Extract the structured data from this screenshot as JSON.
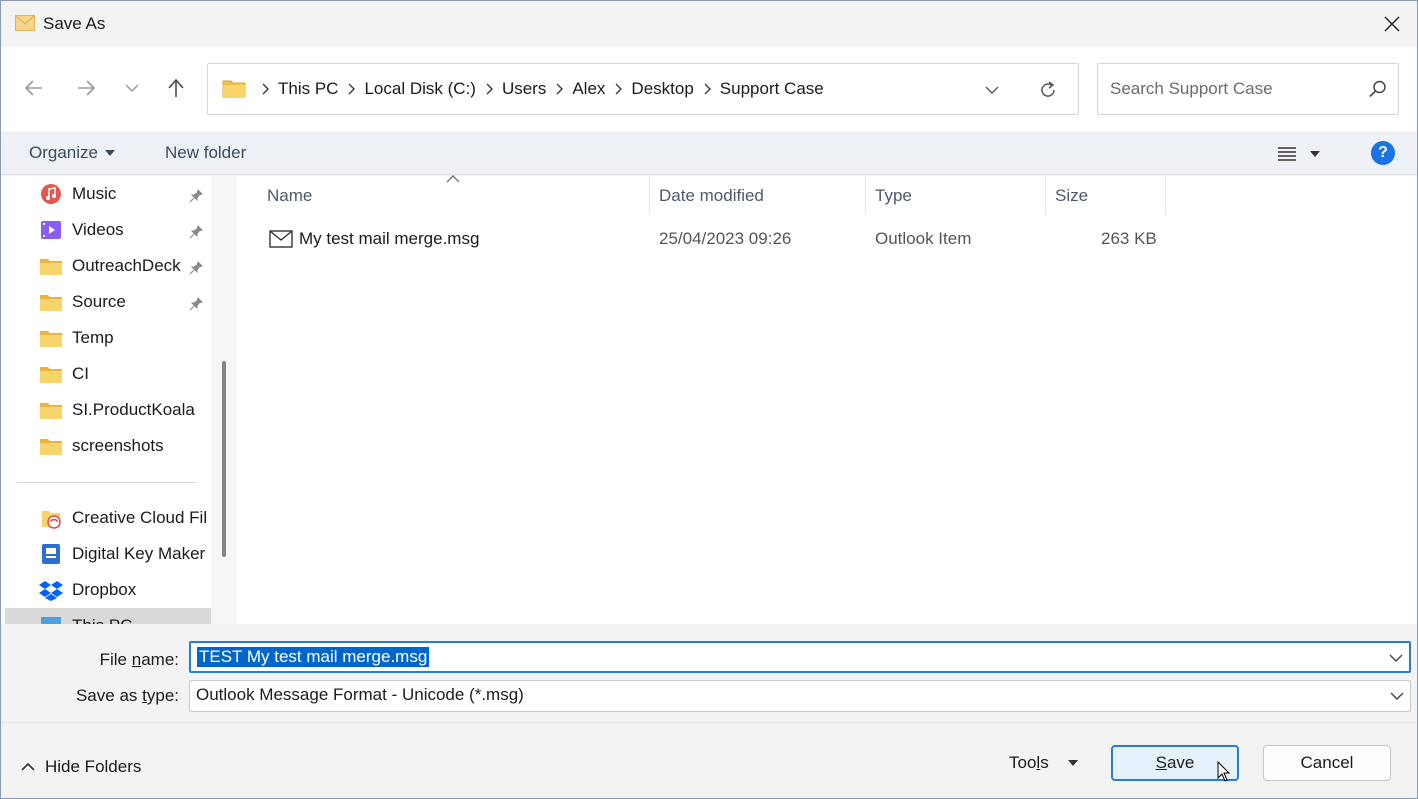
{
  "window": {
    "title": "Save As",
    "icon": "envelope-icon"
  },
  "nav": {
    "back_icon": "back-arrow-icon",
    "forward_icon": "forward-arrow-icon",
    "recent_icon": "chevron-down-icon",
    "up_icon": "up-arrow-icon"
  },
  "address": {
    "crumbs": [
      "This PC",
      "Local Disk (C:)",
      "Users",
      "Alex",
      "Desktop",
      "Support Case"
    ]
  },
  "search": {
    "placeholder": "Search Support Case"
  },
  "toolbar": {
    "organize_label": "Organize",
    "new_folder_label": "New folder",
    "help_label": "?"
  },
  "sidebar": {
    "items": [
      {
        "label": "Music",
        "icon": "music-icon",
        "pinned": true
      },
      {
        "label": "Videos",
        "icon": "videos-icon",
        "pinned": true
      },
      {
        "label": "OutreachDeck",
        "icon": "folder-icon",
        "pinned": true
      },
      {
        "label": "Source",
        "icon": "folder-icon",
        "pinned": true
      },
      {
        "label": "Temp",
        "icon": "folder-icon",
        "pinned": false
      },
      {
        "label": "CI",
        "icon": "folder-icon",
        "pinned": false
      },
      {
        "label": "SI.ProductKoala",
        "icon": "folder-icon",
        "pinned": false
      },
      {
        "label": "screenshots",
        "icon": "folder-icon",
        "pinned": false
      },
      {
        "label": "Creative Cloud Fil",
        "icon": "creative-cloud-icon",
        "pinned": false
      },
      {
        "label": "Digital Key Maker",
        "icon": "digital-key-maker-icon",
        "pinned": false
      },
      {
        "label": "Dropbox",
        "icon": "dropbox-icon",
        "pinned": false
      },
      {
        "label": "This PC",
        "icon": "this-pc-icon",
        "pinned": false
      }
    ]
  },
  "columns": {
    "name": "Name",
    "date_modified": "Date modified",
    "type": "Type",
    "size": "Size"
  },
  "files": [
    {
      "name": "My test mail merge.msg",
      "date_modified": "25/04/2023 09:26",
      "type": "Outlook Item",
      "size": "263 KB",
      "icon": "envelope-icon"
    }
  ],
  "form": {
    "file_name_label": "File name:",
    "file_name_value": "TEST My test mail merge.msg",
    "save_type_label": "Save as type:",
    "save_type_value": "Outlook Message Format - Unicode (*.msg)"
  },
  "buttons": {
    "hide_folders": "Hide Folders",
    "tools": "Tools",
    "save": "Save",
    "cancel": "Cancel"
  },
  "colors": {
    "accent": "#2b7bd6",
    "selection": "#0066cc",
    "folder": "#f2c14e",
    "help": "#1a73e8"
  }
}
